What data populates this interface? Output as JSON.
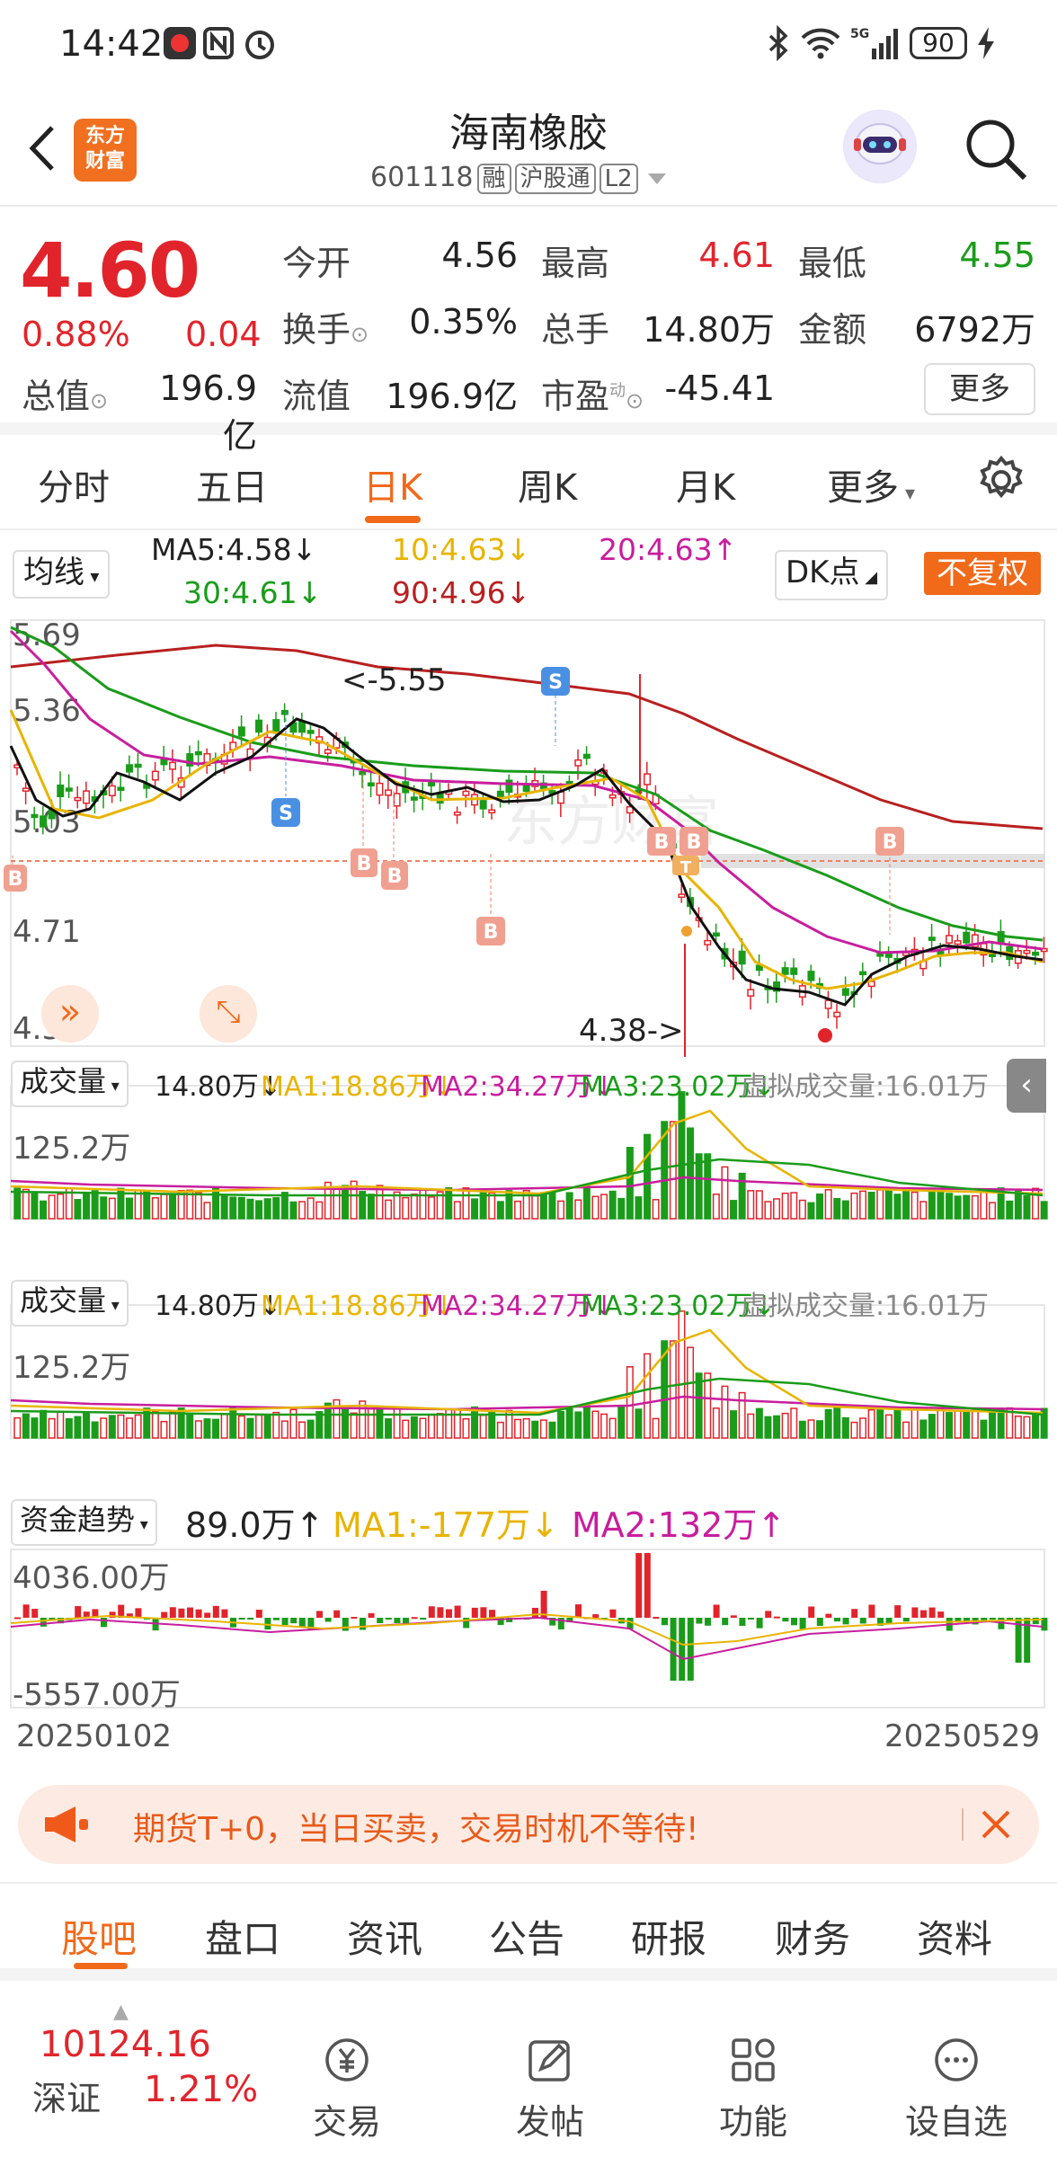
{
  "status_bar": {
    "time": "14:42",
    "battery": "90"
  },
  "header": {
    "title": "海南橡胶",
    "code": "601118",
    "tags": [
      "融",
      "沪股通",
      "L2"
    ],
    "logo_lines": [
      "东方",
      "财富"
    ]
  },
  "quote": {
    "price": "4.60",
    "change_pct": "0.88%",
    "change": "0.04",
    "open_label": "今开",
    "open": "4.56",
    "high_label": "最高",
    "high": "4.61",
    "low_label": "最低",
    "low": "4.55",
    "turnover_label": "换手",
    "turnover": "0.35%",
    "volume_label": "总手",
    "volume": "14.80万",
    "amount_label": "金额",
    "amount": "6792万",
    "mktcap_label": "总值",
    "mktcap": "196.9亿",
    "float_label": "流值",
    "float": "196.9亿",
    "pe_label": "市盈",
    "pe_sup": "动",
    "pe": "-45.41",
    "more": "更多",
    "colors": {
      "up": "#e1242b",
      "down": "#1a9c1a"
    }
  },
  "kline_tabs": {
    "items": [
      "分时",
      "五日",
      "日K",
      "周K",
      "月K",
      "更多"
    ],
    "active": "日K"
  },
  "chart": {
    "ma_selector": "均线",
    "ma5": "MA5:4.58↓",
    "ma10": "10:4.63↓",
    "ma20": "20:4.63↑",
    "ma30": "30:4.61↓",
    "ma90": "90:4.96↓",
    "dk": "DK点",
    "fuquan": "不复权",
    "axis": [
      "5.69",
      "5.36",
      "5.03",
      "4.71",
      "4.38"
    ],
    "high_note": "<-5.55",
    "low_note": "4.38->",
    "vol1": {
      "label": "成交量",
      "val": "14.80万↓",
      "ma1": "MA1:18.86万↓",
      "ma2": "MA2:34.27万↓",
      "ma3": "MA3:23.02万↓",
      "virtual": "虚拟成交量:16.01万",
      "max": "125.2万"
    },
    "vol2": {
      "label": "成交量",
      "val": "14.80万↓",
      "ma1": "MA1:18.86万↓",
      "ma2": "MA2:34.27万↓",
      "ma3": "MA3:23.02万↓",
      "virtual": "虚拟成交量:16.01万",
      "max": "125.2万"
    },
    "fund": {
      "label": "资金趋势",
      "val": "89.0万↑",
      "ma1": "MA1:-177万↓",
      "ma2": "MA2:132万↑",
      "max": "4036.00万",
      "min": "-5557.00万"
    },
    "date_start": "20250102",
    "date_end": "20250529",
    "watermark": "东方财富"
  },
  "ad": {
    "text": "期货T+0，当日买卖，交易时机不等待!"
  },
  "bottom_tabs": {
    "items": [
      "股吧",
      "盘口",
      "资讯",
      "公告",
      "研报",
      "财务",
      "资料"
    ],
    "active": "股吧"
  },
  "nav": {
    "index_value": "10124.16",
    "index_name": "深证",
    "index_pct": "1.21%",
    "trade": "交易",
    "post": "发帖",
    "function": "功能",
    "watch": "设自选"
  }
}
